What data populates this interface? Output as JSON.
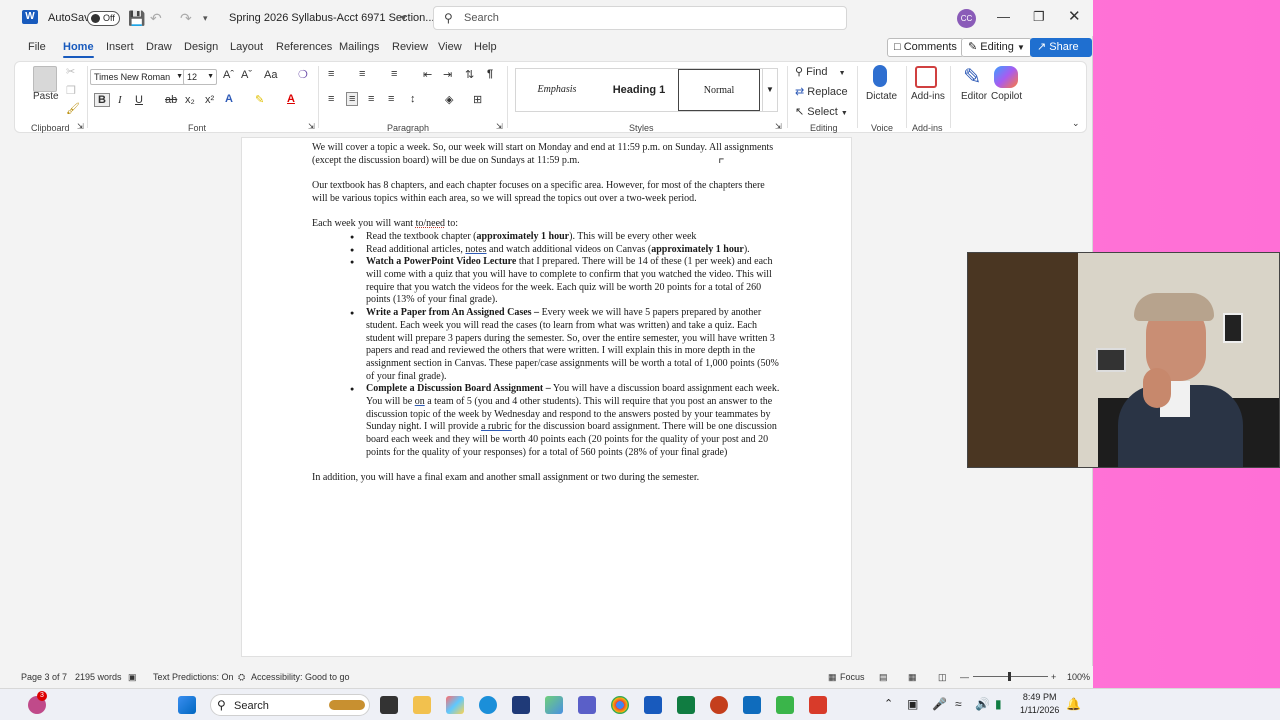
{
  "titlebar": {
    "autosave_label": "AutoSave",
    "autosave_state": "Off",
    "doc_title": "Spring 2026 Syllabus-Acct 6971 Section...",
    "search_placeholder": "Search",
    "avatar_initials": "CC"
  },
  "menu": {
    "tabs": [
      "File",
      "Home",
      "Insert",
      "Draw",
      "Design",
      "Layout",
      "References",
      "Mailings",
      "Review",
      "View",
      "Help"
    ],
    "active_tab": "Home",
    "comments_label": "Comments",
    "editing_label": "Editing",
    "share_label": "Share"
  },
  "ribbon": {
    "clipboard": {
      "paste_label": "Paste",
      "group_label": "Clipboard"
    },
    "font": {
      "font_name": "Times New Roman",
      "font_size": "12",
      "group_label": "Font",
      "change_case": "Aa"
    },
    "paragraph": {
      "group_label": "Paragraph"
    },
    "styles": {
      "items": [
        "Emphasis",
        "Heading 1",
        "Normal"
      ],
      "selected": "Normal",
      "group_label": "Styles"
    },
    "editing": {
      "find_label": "Find",
      "replace_label": "Replace",
      "select_label": "Select",
      "group_label": "Editing"
    },
    "voice": {
      "dictate_label": "Dictate",
      "group_label": "Voice"
    },
    "addins": {
      "addins_label": "Add-ins",
      "group_label": "Add-ins",
      "editor_label": "Editor",
      "copilot_label": "Copilot"
    }
  },
  "document": {
    "p1": "We will cover a topic a week. So, our week will start on Monday and end at 11:59 p.m. on Sunday.  All assignments (except the discussion board) will be due on Sundays at 11:59 p.m.",
    "p2": "Our textbook has 8 chapters, and each chapter focuses on a specific area.  However, for most of the chapters there will be various topics within each area, so we will spread the topics out over a two-week period.",
    "p3_intro": "Each week you will want ",
    "p3_underlined": "to/need",
    "p3_end": " to:",
    "bullets": {
      "b1_pre": "Read the textbook chapter (",
      "b1_bold": "approximately 1 hour",
      "b1_post": "). This will be every other week",
      "b2_pre": "Read additional articles, ",
      "b2_underlined": "notes",
      "b2_mid": " and watch additional videos on Canvas (",
      "b2_bold": "approximately 1 hour",
      "b2_post": ").",
      "b3_bold": "Watch a PowerPoint Video Lecture",
      "b3_text": " that I prepared.  There will be 14 of these (1 per week) and each will come with a quiz that you will have to complete to confirm that you watched the video.  This will require that you watch the videos for the week.  Each quiz will be worth 20 points for a total of 260 points (13% of your final grade).",
      "b4_bold": "Write a Paper from An Assigned Cases –",
      "b4_text": " Every week we will have 5 papers prepared by another student. Each week you will read the cases (to learn from what was written) and take a quiz.  Each student will prepare 3 papers during the semester.  So, over the entire semester, you will have written 3 papers and read and reviewed the others that were written.  I will explain this in more depth in the assignment section in Canvas. These paper/case assignments will be worth a total of 1,000 points (50% of your final grade).",
      "b5_bold": "Complete a Discussion Board Assignment –",
      "b5_text_a": " You will have a discussion board assignment each week.  You will be ",
      "b5_underlined_on": "on",
      "b5_text_b": " a team of 5 (you and 4 other students).  This will require that you post an answer to the discussion topic of the week by Wednesday and respond to the answers posted by your teammates by Sunday night.  I will provide ",
      "b5_underlined_rubric": "a rubric",
      "b5_text_c": " for the discussion board assignment. There will be one discussion board each week and they will be worth 40 points each (20 points for the quality of your post and 20 points for the quality of your responses) for a total of 560 points (28% of your final grade)"
    },
    "p4": "In addition, you will have a final exam and another small assignment or two during the semester."
  },
  "statusbar": {
    "page": "Page 3 of 7",
    "words": "2195 words",
    "text_predictions": "Text Predictions: On",
    "accessibility": "Accessibility: Good to go",
    "focus": "Focus",
    "zoom": "100%"
  },
  "taskbar": {
    "search_label": "Search",
    "time": "8:49 PM",
    "date": "1/11/2026",
    "notification_badge": "3"
  },
  "colors": {
    "accent": "#185abd",
    "share_button": "#1f6fd0",
    "desktop": "#ff6fd6"
  }
}
